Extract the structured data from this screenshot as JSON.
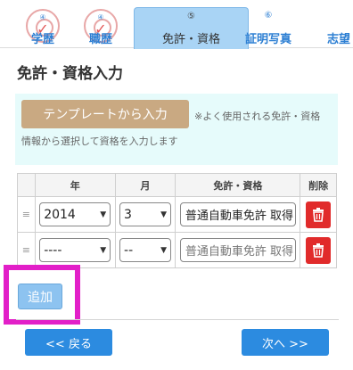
{
  "tabs": [
    {
      "num": "④",
      "label": "学歴",
      "state": "done"
    },
    {
      "num": "④",
      "label": "職歴",
      "state": "done"
    },
    {
      "num": "⑤",
      "label": "免許・資格",
      "state": "active"
    },
    {
      "num": "⑥",
      "label": "証明写真",
      "state": "plain"
    },
    {
      "num": "",
      "label": "志望",
      "state": "plain"
    }
  ],
  "title": "免許・資格入力",
  "template": {
    "button_label": "テンプレートから入力",
    "note_line1": "※よく使用される免許・資格",
    "note_line2": "情報から選択して資格を入力します"
  },
  "table": {
    "headers": [
      "",
      "年",
      "月",
      "免許・資格",
      "削除"
    ],
    "rows": [
      {
        "handle": "≡",
        "year": "2014",
        "month": "3",
        "license": "普通自動車免許 取得",
        "license_is_placeholder": false
      },
      {
        "handle": "≡",
        "year": "----",
        "month": "--",
        "license": "普通自動車免許 取得",
        "license_is_placeholder": true
      }
    ]
  },
  "add_label": "追加",
  "nav": {
    "back": "<< 戻る",
    "next": "次へ >>"
  },
  "colors": {
    "accent": "#2c8be0",
    "delete": "#e12b2b",
    "highlight": "#e21fc8",
    "template_button": "#c9a982"
  }
}
